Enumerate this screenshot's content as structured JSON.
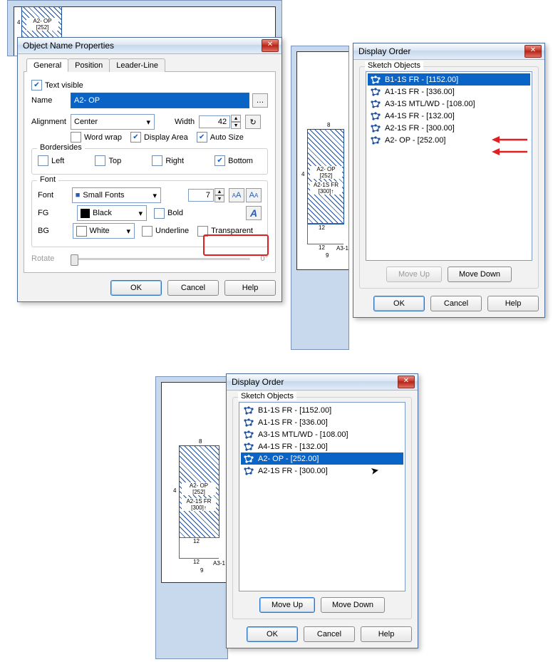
{
  "props": {
    "title": "Object Name Properties",
    "tabs": [
      "General",
      "Position",
      "Leader-Line"
    ],
    "text_visible_label": "Text visible",
    "name_label": "Name",
    "name_value": "A2- OP",
    "alignment_label": "Alignment",
    "alignment_value": "Center",
    "width_label": "Width",
    "width_value": "42",
    "word_wrap_label": "Word wrap",
    "display_area_label": "Display Area",
    "auto_size_label": "Auto Size",
    "bordersides_label": "Bordersides",
    "left_label": "Left",
    "top_label": "Top",
    "right_label": "Right",
    "bottom_label": "Bottom",
    "font_group_label": "Font",
    "font_label": "Font",
    "font_value": "Small Fonts",
    "font_size": "7",
    "fg_label": "FG",
    "fg_value": "Black",
    "bold_label": "Bold",
    "bg_label": "BG",
    "bg_value": "White",
    "underline_label": "Underline",
    "transparent_label": "Transparent",
    "rotate_label": "Rotate",
    "rotate_value": "0°",
    "ok": "OK",
    "cancel": "Cancel",
    "help": "Help"
  },
  "order1": {
    "title": "Display Order",
    "group_label": "Sketch Objects",
    "items": [
      "B1-1S FR - [1152.00]",
      "A1-1S FR - [336.00]",
      "A3-1S MTL/WD - [108.00]",
      "A4-1S FR - [132.00]",
      "A2-1S FR - [300.00]",
      "A2- OP  - [252.00]"
    ],
    "selected_index": 0,
    "move_up": "Move Up",
    "move_down": "Move Down",
    "ok": "OK",
    "cancel": "Cancel",
    "help": "Help"
  },
  "order2": {
    "title": "Display Order",
    "group_label": "Sketch Objects",
    "items": [
      "B1-1S FR - [1152.00]",
      "A1-1S FR - [336.00]",
      "A3-1S MTL/WD - [108.00]",
      "A4-1S FR - [132.00]",
      "A2- OP  - [252.00]",
      "A2-1S FR - [300.00]"
    ],
    "selected_index": 4,
    "move_up": "Move Up",
    "move_down": "Move Down",
    "ok": "OK",
    "cancel": "Cancel",
    "help": "Help"
  },
  "canvas_labels": {
    "a2op": "A2- OP",
    "a2op_area": "[252]",
    "a2fr": "A2-1S FR",
    "a2fr_area": "[300]↑",
    "a3": "A3-1",
    "dim4": "4",
    "dim8": "8",
    "dim12": "12",
    "dim9": "9"
  }
}
